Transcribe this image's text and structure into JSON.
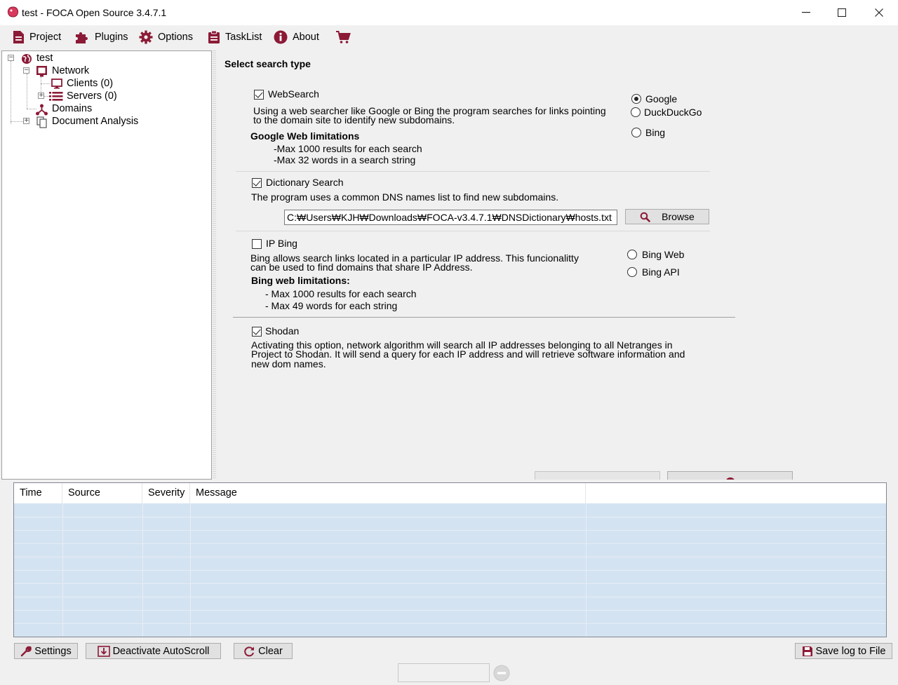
{
  "window": {
    "title": "test - FOCA Open Source 3.4.7.1"
  },
  "menu": {
    "items": [
      {
        "label": "Project",
        "icon": "document-icon"
      },
      {
        "label": "Plugins",
        "icon": "puzzle-icon"
      },
      {
        "label": "Options",
        "icon": "gear-icon"
      },
      {
        "label": "TaskList",
        "icon": "clipboard-icon"
      },
      {
        "label": "About",
        "icon": "info-icon"
      },
      {
        "label": "",
        "icon": "cart-icon"
      }
    ]
  },
  "tree": {
    "root": "test",
    "network": "Network",
    "clients": "Clients (0)",
    "servers": "Servers (0)",
    "domains": "Domains",
    "document_analysis": "Document Analysis"
  },
  "search": {
    "heading": "Select search type",
    "websearch": {
      "label": "WebSearch",
      "checked": true,
      "desc_line1": "Using a web searcher like Google or Bing the program searches for links pointing",
      "desc_line2": "to the domain site to identify new subdomains.",
      "limits_title": "Google Web  limitations",
      "limit1": "-Max 1000 results for each search",
      "limit2": "-Max 32 words in a search string",
      "engines": [
        {
          "label": "Google",
          "selected": true
        },
        {
          "label": "DuckDuckGo",
          "selected": false
        },
        {
          "label": "Bing",
          "selected": false
        }
      ]
    },
    "dictionary": {
      "label": "Dictionary Search",
      "checked": true,
      "desc": "The program uses a common DNS names list to find new subdomains.",
      "path": "C:₩Users₩KJH₩Downloads₩FOCA-v3.4.7.1₩DNSDictionary₩hosts.txt",
      "browse_label": "Browse"
    },
    "ipbing": {
      "label": "IP Bing",
      "checked": false,
      "desc_line1": "Bing allows search links located in a particular IP address. This funcionalitty",
      "desc_line2": "can be used to find domains that share IP Address.",
      "limits_title": "Bing web limitations:",
      "limit1": "- Max 1000 results for each search",
      "limit2": "- Max 49 words for each string",
      "options": [
        {
          "label": "Bing Web",
          "selected": false
        },
        {
          "label": "Bing API",
          "selected": false
        }
      ]
    },
    "shodan": {
      "label": "Shodan",
      "checked": true,
      "desc_line1": "Activating this option, network algorithm will search all IP addresses belonging to all Netranges in",
      "desc_line2": "Project to Shodan. It will send a query for each IP address and will retrieve software information and",
      "desc_line3": "new dom names."
    }
  },
  "log": {
    "columns": [
      "Time",
      "Source",
      "Severity",
      "Message",
      ""
    ],
    "rows": []
  },
  "bottom": {
    "settings_label": "Settings",
    "autoscroll_label": "Deactivate AutoScroll",
    "clear_label": "Clear",
    "save_label": "Save log to File"
  },
  "colors": {
    "accent": "#8b1a36",
    "grid_bg": "#d4e3f1"
  }
}
